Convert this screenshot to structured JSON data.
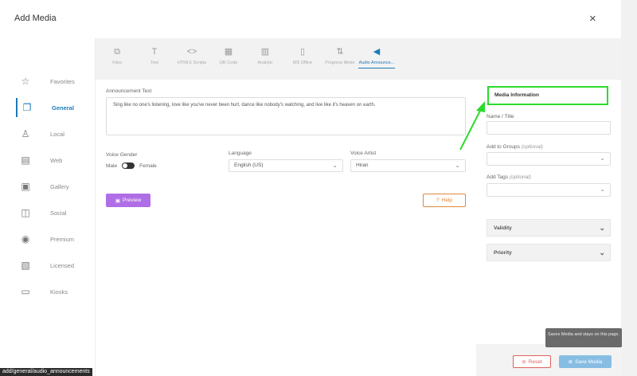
{
  "dialog": {
    "title": "Add Media",
    "close_glyph": "×"
  },
  "sidebar": {
    "items": [
      {
        "label": "Favorites",
        "icon": "star-icon",
        "glyph": "☆"
      },
      {
        "label": "General",
        "icon": "copy-icon",
        "glyph": "❐",
        "active": true
      },
      {
        "label": "Local",
        "icon": "local-icon",
        "glyph": "♙"
      },
      {
        "label": "Web",
        "icon": "web-icon",
        "glyph": "▤"
      },
      {
        "label": "Gallery",
        "icon": "gallery-icon",
        "glyph": "▣"
      },
      {
        "label": "Social",
        "icon": "social-icon",
        "glyph": "◫"
      },
      {
        "label": "Premium",
        "icon": "premium-icon",
        "glyph": "◉"
      },
      {
        "label": "Licensed",
        "icon": "licensed-icon",
        "glyph": "▧"
      },
      {
        "label": "Kiosks",
        "icon": "kiosk-icon",
        "glyph": "▭"
      }
    ]
  },
  "tabs": [
    {
      "label": "Files",
      "icon": "files-icon",
      "glyph": "⧉"
    },
    {
      "label": "Text",
      "icon": "text-icon",
      "glyph": "T"
    },
    {
      "label": "HTML5 Scripts",
      "icon": "code-icon",
      "glyph": "<>"
    },
    {
      "label": "QR Code",
      "icon": "qr-icon",
      "glyph": "▦"
    },
    {
      "label": "Analytic",
      "icon": "analytic-icon",
      "glyph": "▥"
    },
    {
      "label": "MS Office",
      "icon": "office-icon",
      "glyph": "▯"
    },
    {
      "label": "Progress Meter",
      "icon": "progress-icon",
      "glyph": "⇅"
    },
    {
      "label": "Audio Announce...",
      "icon": "megaphone-icon",
      "glyph": "◀"
    }
  ],
  "form": {
    "announcement_label": "Announcement Text",
    "announcement_value": "Sing like no one's listening, love like you've never been hurt, dance like nobody's watching, and live like it's heaven on earth.",
    "voice_gender_label": "Voice Gender",
    "male_label": "Male",
    "female_label": "Female",
    "language_label": "Language",
    "language_value": "English (US)",
    "voice_artist_label": "Voice Artist",
    "voice_artist_value": "Hiran",
    "preview_label": "Preview",
    "help_label": "Help"
  },
  "media_info": {
    "header": "Media Information",
    "name_label": "Name / Title",
    "groups_label": "Add to Groups",
    "tags_label": "Add Tags",
    "optional": "(optional)",
    "validity_label": "Validity",
    "priority_label": "Priority"
  },
  "footer": {
    "tooltip": "Saves Media and stays on this page.",
    "reset_label": "Reset",
    "save_label": "Save Media"
  },
  "status_url": "add/general/audio_announcements",
  "colors": {
    "accent": "#1c7ab6",
    "preview": "#b06ee6",
    "help": "#e0883a",
    "reset": "#e0605a",
    "save": "#87bde3",
    "highlight": "#2bdb2b"
  }
}
